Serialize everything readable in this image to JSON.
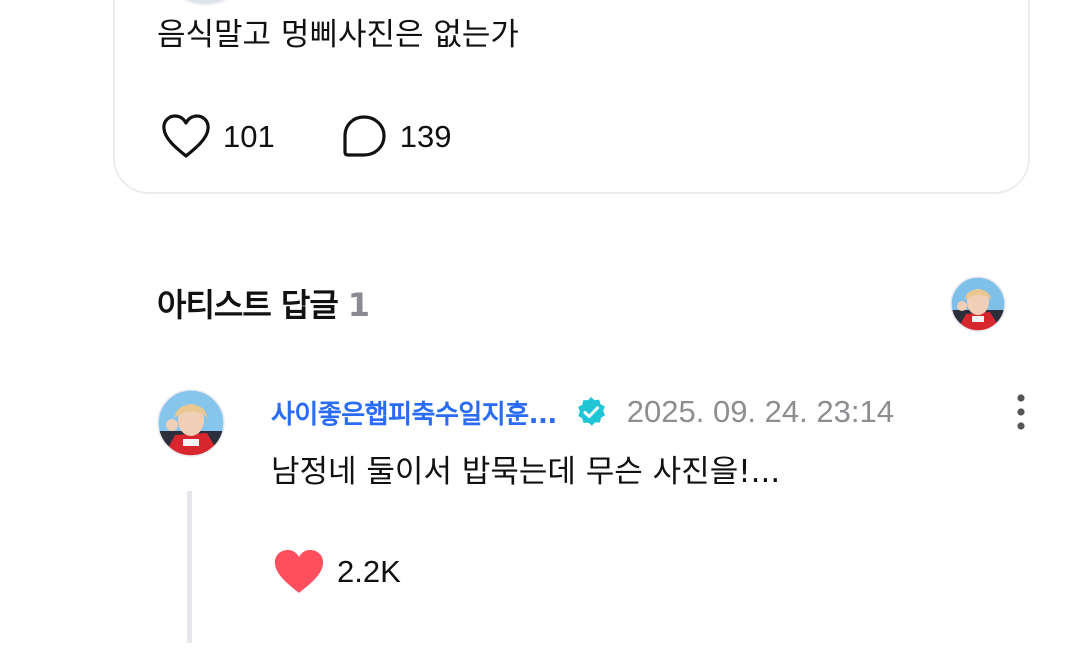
{
  "post": {
    "text": "음식말고 멍삐사진은 없는가",
    "like_count": "101",
    "comment_count": "139"
  },
  "artist_replies": {
    "title": "아티스트 답글",
    "count": "1"
  },
  "reply": {
    "author_name": "사이좋은햅피축수일지훈...",
    "date": "2025. 09. 24. 23:14",
    "text": "남정네 둘이서 밥묵는데 무슨 사진을!...",
    "like_count": "2.2K"
  },
  "icons": {
    "like": "heart-outline-icon",
    "comment": "speech-bubble-icon",
    "verified": "verified-check-badge-icon",
    "more": "vertical-dots-icon",
    "reply_like": "heart-filled-icon"
  },
  "colors": {
    "author_name": "#2a6cf6",
    "verified_badge": "#1fc6d6",
    "heart_filled": "#ff4f5e",
    "muted_text": "#8d8d92",
    "card_border": "#ececf0"
  }
}
